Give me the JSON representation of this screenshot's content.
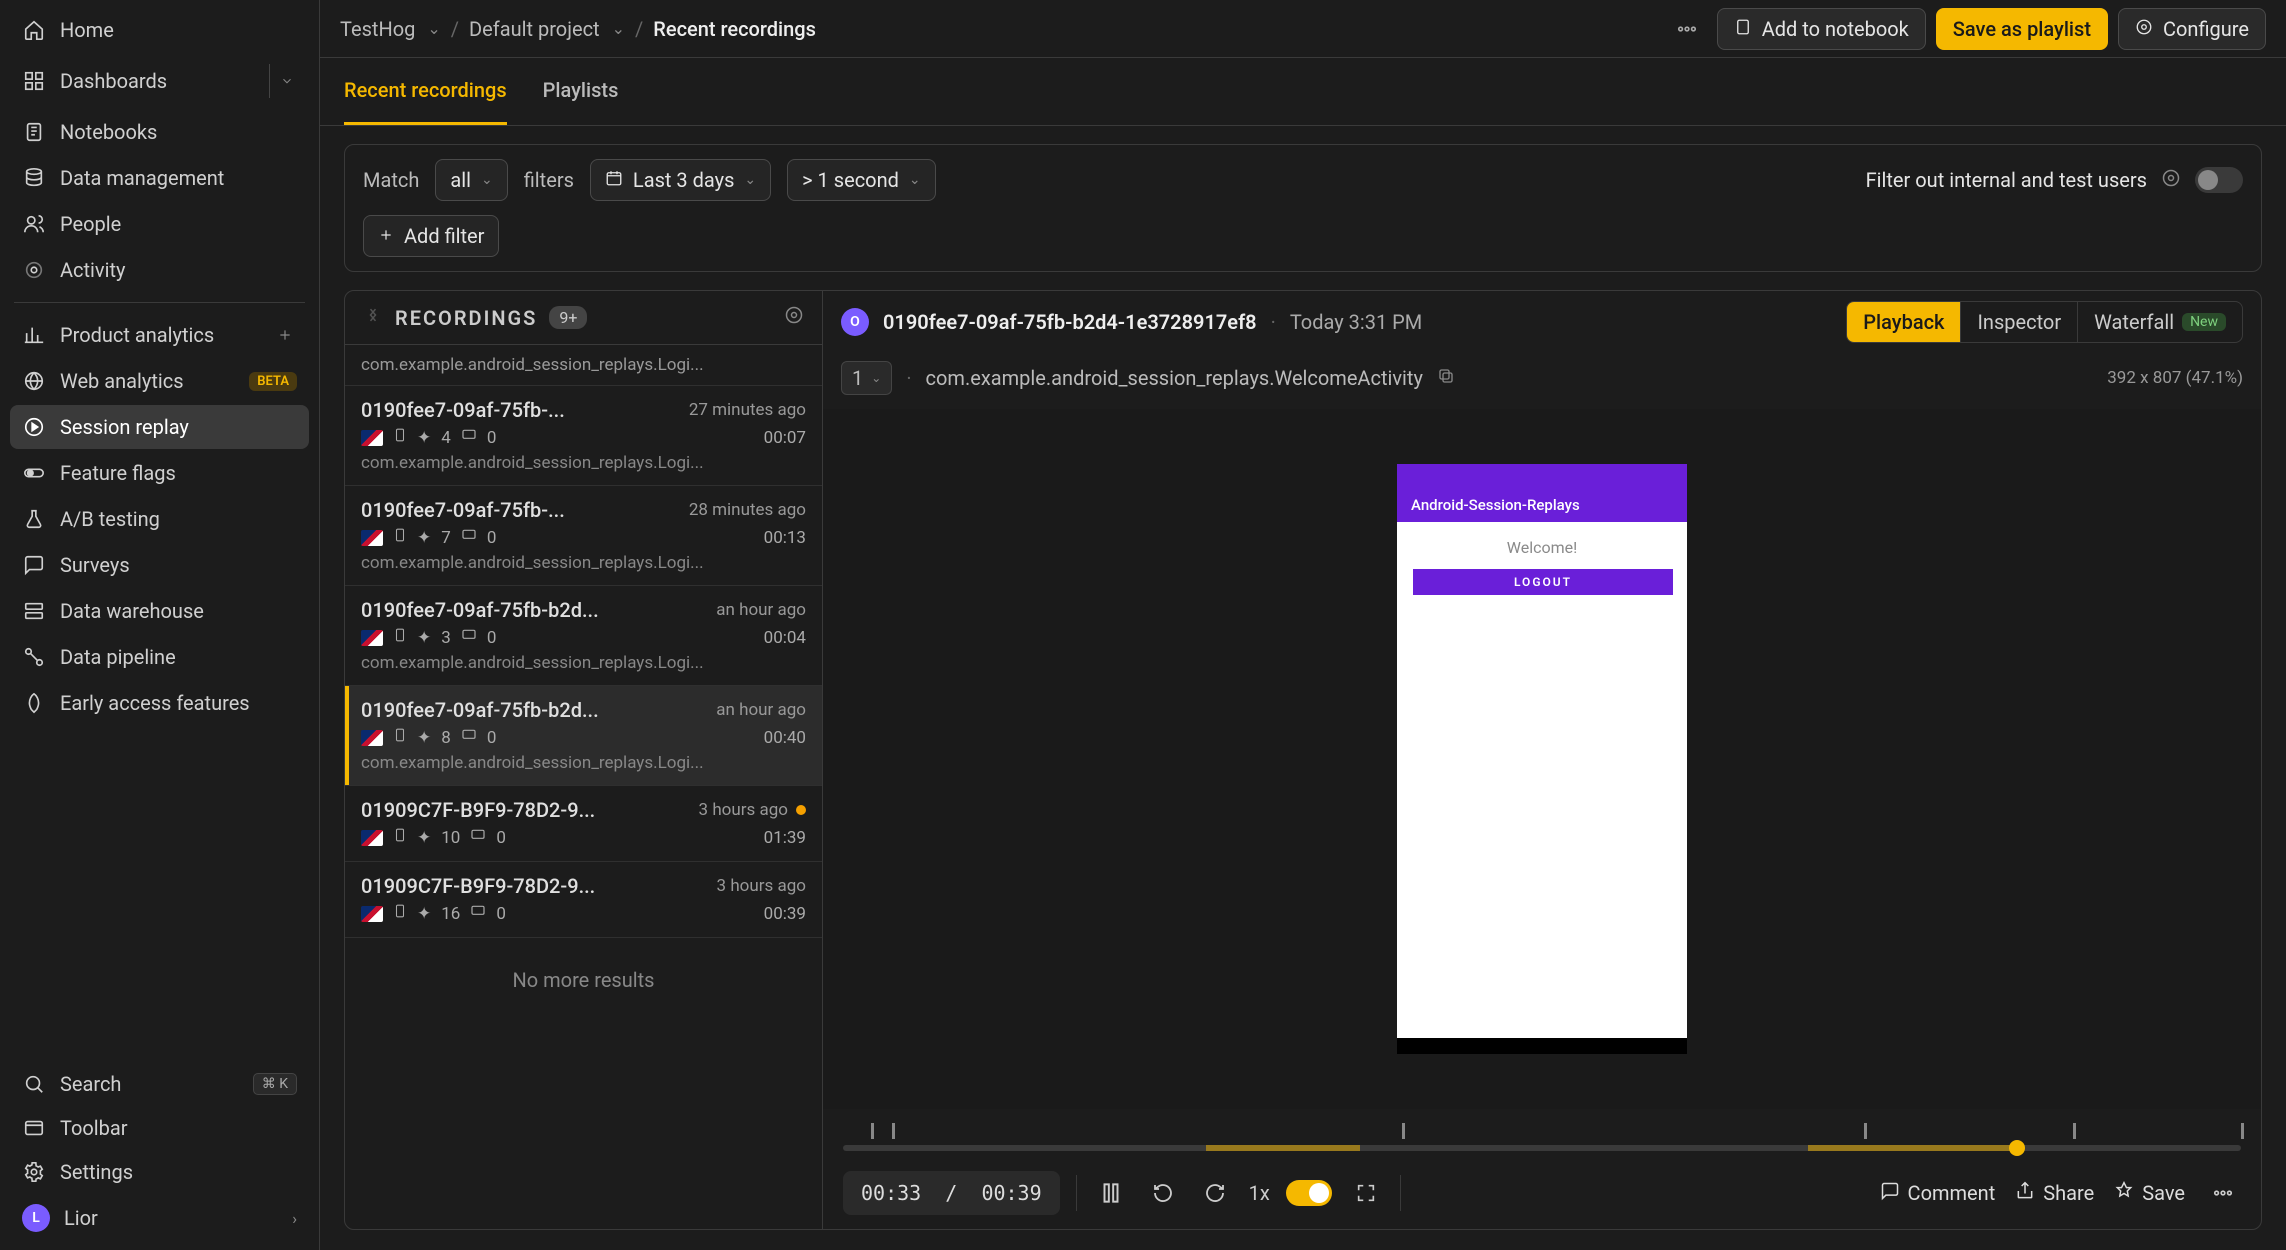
{
  "breadcrumb": {
    "org": "TestHog",
    "project": "Default project",
    "page": "Recent recordings"
  },
  "topbar": {
    "add_notebook": "Add to notebook",
    "save_playlist": "Save as playlist",
    "configure": "Configure"
  },
  "tabs": {
    "recent": "Recent recordings",
    "playlists": "Playlists"
  },
  "filters": {
    "match": "Match",
    "all": "all",
    "filters_label": "filters",
    "range": "Last 3 days",
    "duration": "> 1 second",
    "add_filter": "Add filter",
    "internal": "Filter out internal and test users"
  },
  "recordings": {
    "title": "RECORDINGS",
    "count": "9+",
    "truncated_top": "com.example.android_session_replays.Logi...",
    "no_more": "No more results",
    "items": [
      {
        "id": "0190fee7-09af-75fb-...",
        "ago": "27 minutes ago",
        "events": "4",
        "chats": "0",
        "dur": "00:07",
        "path": "com.example.android_session_replays.Logi..."
      },
      {
        "id": "0190fee7-09af-75fb-...",
        "ago": "28 minutes ago",
        "events": "7",
        "chats": "0",
        "dur": "00:13",
        "path": "com.example.android_session_replays.Logi..."
      },
      {
        "id": "0190fee7-09af-75fb-b2d...",
        "ago": "an hour ago",
        "events": "3",
        "chats": "0",
        "dur": "00:04",
        "path": "com.example.android_session_replays.Logi..."
      },
      {
        "id": "0190fee7-09af-75fb-b2d...",
        "ago": "an hour ago",
        "events": "8",
        "chats": "0",
        "dur": "00:40",
        "path": "com.example.android_session_replays.Logi..."
      },
      {
        "id": "01909C7F-B9F9-78D2-9...",
        "ago": "3 hours ago",
        "events": "10",
        "chats": "0",
        "dur": "01:39",
        "path": ""
      },
      {
        "id": "01909C7F-B9F9-78D2-9...",
        "ago": "3 hours ago",
        "events": "16",
        "chats": "0",
        "dur": "00:39",
        "path": ""
      }
    ]
  },
  "player": {
    "avatar_letter": "O",
    "id": "0190fee7-09af-75fb-b2d4-1e3728917ef8",
    "date": "Today 3:31 PM",
    "seg_playback": "Playback",
    "seg_inspector": "Inspector",
    "seg_waterfall": "Waterfall",
    "seg_new": "New",
    "window": "1",
    "activity": "com.example.android_session_replays.WelcomeActivity",
    "dimensions": "392 x 807 (47.1%)",
    "phone": {
      "appbar": "Android-Session-Replays",
      "welcome": "Welcome!",
      "logout": "LOGOUT"
    },
    "time_current": "00:33",
    "time_total": "00:39",
    "speed": "1x",
    "comment": "Comment",
    "share": "Share",
    "save": "Save"
  },
  "sidebar": {
    "home": "Home",
    "dashboards": "Dashboards",
    "notebooks": "Notebooks",
    "data_management": "Data management",
    "people": "People",
    "activity": "Activity",
    "product_analytics": "Product analytics",
    "web_analytics": "Web analytics",
    "beta": "BETA",
    "session_replay": "Session replay",
    "feature_flags": "Feature flags",
    "ab_testing": "A/B testing",
    "surveys": "Surveys",
    "data_warehouse": "Data warehouse",
    "data_pipeline": "Data pipeline",
    "early_access": "Early access features",
    "search": "Search",
    "search_key": "⌘ K",
    "toolbar": "Toolbar",
    "settings": "Settings",
    "user": "Lior",
    "user_initial": "L"
  }
}
